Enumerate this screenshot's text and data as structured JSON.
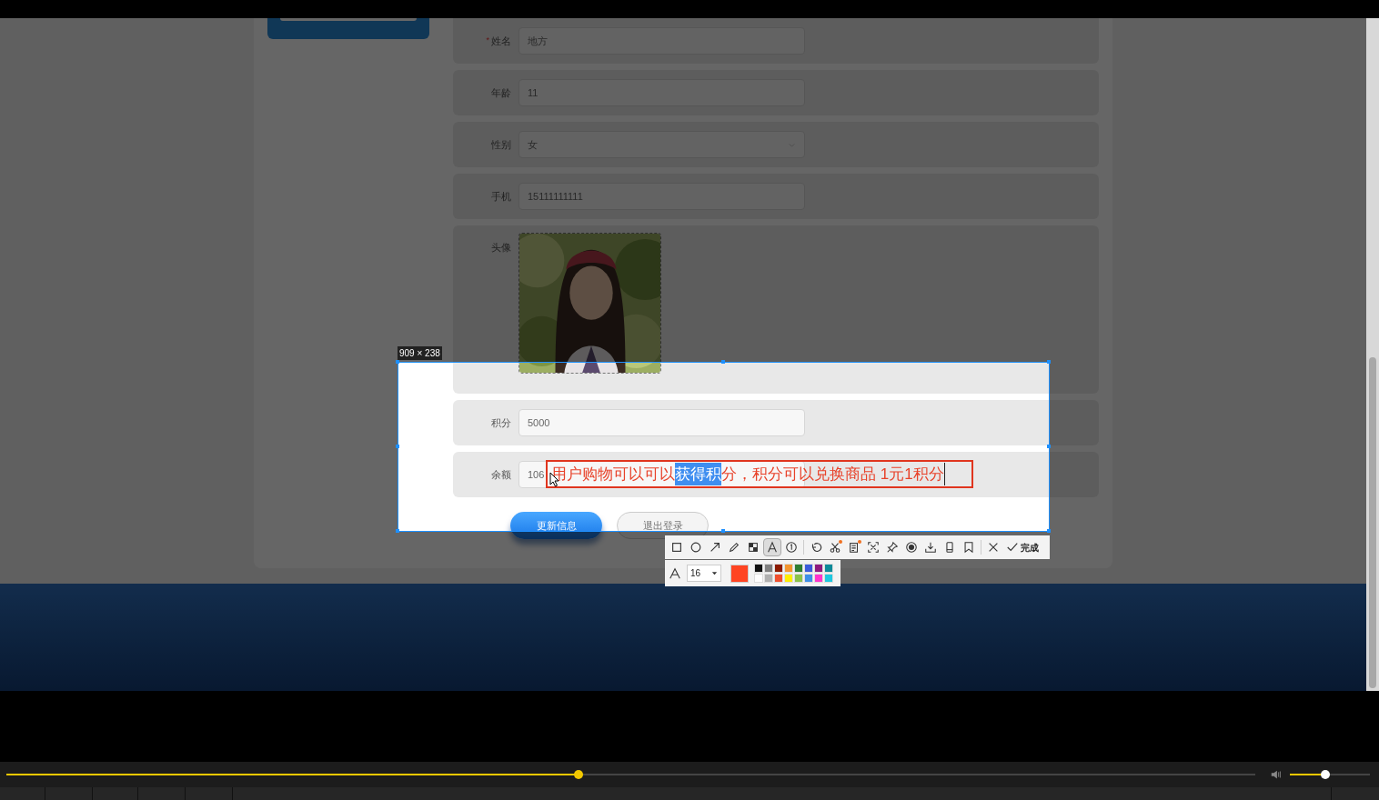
{
  "form": {
    "rows": [
      {
        "label": "姓名",
        "required_mark": "*",
        "kind": "text",
        "value": "地方"
      },
      {
        "label": "年龄",
        "kind": "text",
        "value": "11"
      },
      {
        "label": "性别",
        "kind": "select",
        "value": "女"
      },
      {
        "label": "手机",
        "kind": "text",
        "value": "15111111111"
      },
      {
        "label": "头像"
      },
      {
        "label": "积分",
        "kind": "text",
        "value": "5000"
      },
      {
        "label": "余额",
        "kind": "text",
        "value": "106"
      }
    ],
    "buttons": [
      {
        "label": "更新信息",
        "kind": "primary"
      },
      {
        "label": "退出登录",
        "kind": "outline"
      }
    ]
  },
  "capture": {
    "size": "909 × 238",
    "annotation": {
      "before": "用户购物可以可以",
      "selected": "获得积",
      "after": "分，积分可以兑换商品 1元1积分"
    },
    "toolbar": {
      "groups": [
        [
          {
            "kind": "rect",
            "selected": false
          },
          {
            "kind": "ellipse",
            "selected": false
          },
          {
            "kind": "arrow",
            "selected": false
          },
          {
            "kind": "pen",
            "selected": false
          },
          {
            "kind": "mosaic",
            "selected": false
          },
          {
            "kind": "text",
            "selected": true
          },
          {
            "kind": "number",
            "selected": false
          }
        ],
        [
          {
            "kind": "undo",
            "selected": false
          },
          {
            "kind": "cut",
            "selected": false,
            "badge": true
          },
          {
            "kind": "ocr",
            "selected": false,
            "badge": true
          },
          {
            "kind": "scan",
            "selected": false
          },
          {
            "kind": "pin",
            "selected": false
          },
          {
            "kind": "record",
            "selected": false
          },
          {
            "kind": "save",
            "selected": false
          },
          {
            "kind": "device",
            "selected": false
          },
          {
            "kind": "bookmark",
            "selected": false
          }
        ],
        [
          {
            "kind": "cancel",
            "selected": false
          },
          {
            "kind": "done",
            "selected": false,
            "label": "完成"
          }
        ]
      ],
      "font_size": "16",
      "current_swatch": {
        "color": "#ff4422"
      },
      "palette": [
        {
          "color": "#111111"
        },
        {
          "color": "#808080"
        },
        {
          "color": "#8b1a00"
        },
        {
          "color": "#f39630"
        },
        {
          "color": "#2e7d32"
        },
        {
          "color": "#3b5bdb"
        },
        {
          "color": "#8e1a7e"
        },
        {
          "color": "#0d8a99"
        },
        {
          "color": "#ffffff"
        },
        {
          "color": "#b0b0b0"
        },
        {
          "color": "#f0502e"
        },
        {
          "color": "#ffee00"
        },
        {
          "color": "#8bc34a"
        },
        {
          "color": "#3d8fe8"
        },
        {
          "color": "#ff33cc"
        },
        {
          "color": "#1ec8e0"
        }
      ]
    }
  },
  "player": {
    "progress": {
      "level": 0.458
    },
    "volume": {
      "level": 0.44
    }
  }
}
